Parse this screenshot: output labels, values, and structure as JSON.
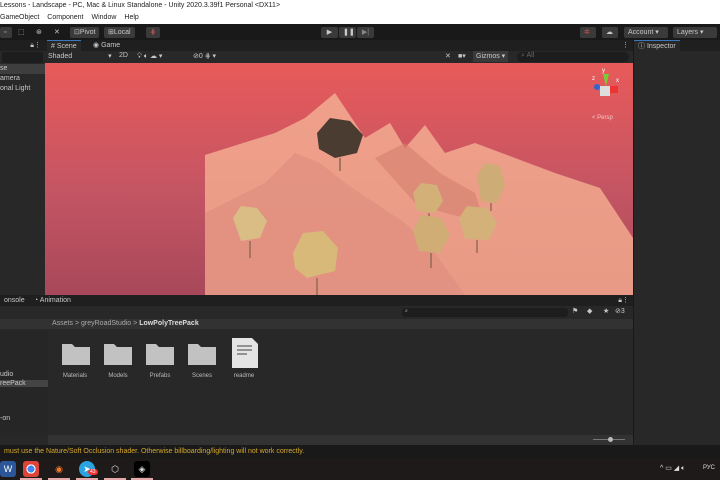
{
  "title": "Lessons - Landscape - PC, Mac & Linux Standalone - Unity 2020.3.39f1 Personal <DX11>",
  "menu": [
    "GameObject",
    "Component",
    "Window",
    "Help"
  ],
  "toolbar": {
    "pivot": "Pivot",
    "local": "Local",
    "account": "Account",
    "layers": "Layers"
  },
  "hierarchy": {
    "items": [
      "se",
      "amera",
      "onal Light"
    ]
  },
  "scene_tabs": [
    "Scene",
    "Game"
  ],
  "scene_toolbar": {
    "shading": "Shaded",
    "mode_2d": "2D",
    "hidden_count": "0",
    "gizmos": "Gizmos",
    "search_placeholder": "All"
  },
  "gizmo": {
    "y": "y",
    "x": "x",
    "z": "z",
    "persp": "< Persp"
  },
  "inspector": {
    "tab": "Inspector"
  },
  "bottom_tabs": [
    "onsole",
    "Animation"
  ],
  "project": {
    "breadcrumb": [
      "Assets",
      "greyRoadStudio",
      "LowPolyTreePack"
    ],
    "tree": [
      "udio",
      "reePack",
      "-on"
    ],
    "items": [
      {
        "name": "Materials",
        "type": "folder"
      },
      {
        "name": "Models",
        "type": "folder"
      },
      {
        "name": "Prefabs",
        "type": "folder"
      },
      {
        "name": "Scenes",
        "type": "folder"
      },
      {
        "name": "readme",
        "type": "file"
      }
    ],
    "hidden_count": "3"
  },
  "status": " must use the Nature/Soft Occlusion shader. Otherwise billboarding/lighting will not work correctly.",
  "taskbar": {
    "telegram_badge": "43",
    "lang": "РУС"
  }
}
